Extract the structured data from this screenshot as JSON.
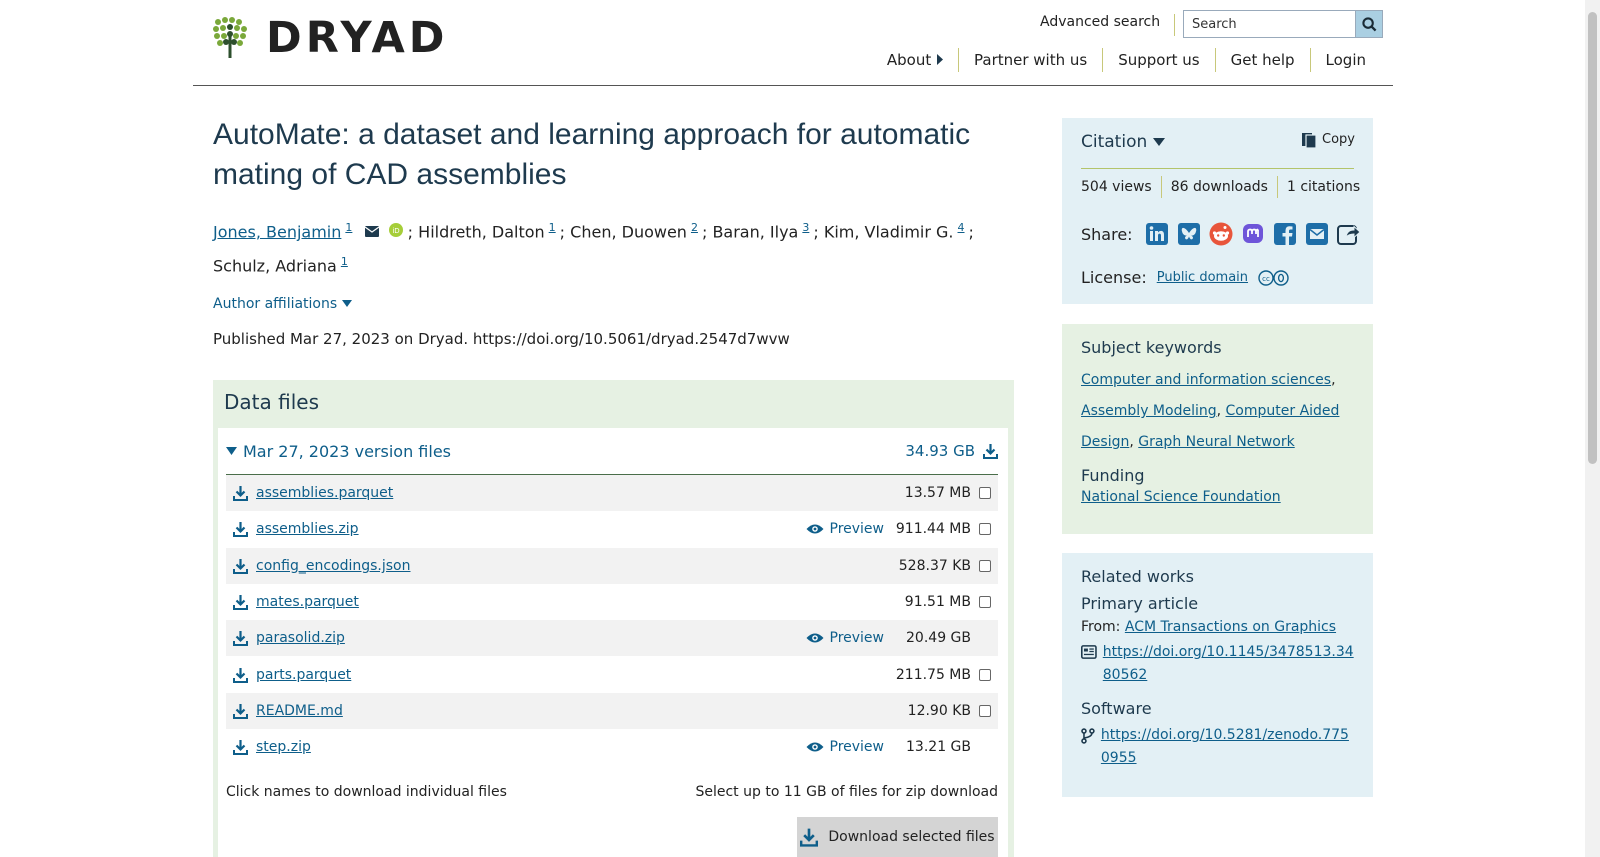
{
  "header": {
    "logo_text": "DRYAD",
    "advanced_search": "Advanced search",
    "search_placeholder": "Search",
    "nav": [
      "About",
      "Partner with us",
      "Support us",
      "Get help",
      "Login"
    ]
  },
  "dataset": {
    "title": "AutoMate: a dataset and learning approach for automatic mating of CAD assemblies",
    "authors": [
      {
        "name": "Jones, Benjamin",
        "aff": "1",
        "linked": true
      },
      {
        "name": "Hildreth, Dalton",
        "aff": "1"
      },
      {
        "name": "Chen, Duowen",
        "aff": "2"
      },
      {
        "name": "Baran, Ilya",
        "aff": "3"
      },
      {
        "name": "Kim, Vladimir G.",
        "aff": "4"
      },
      {
        "name": "Schulz, Adriana",
        "aff": "1"
      }
    ],
    "separator": ";",
    "affiliations_toggle": "Author affiliations",
    "published": "Published Mar 27, 2023 on Dryad. https://doi.org/10.5061/dryad.2547d7wvw"
  },
  "data_files": {
    "heading": "Data files",
    "version_label": "Mar 27, 2023 version files",
    "version_size": "34.93 GB",
    "preview_label": "Preview",
    "files": [
      {
        "name": "assemblies.parquet",
        "size": "13.57 MB",
        "preview": false,
        "checkbox": true
      },
      {
        "name": "assemblies.zip",
        "size": "911.44 MB",
        "preview": true,
        "checkbox": true
      },
      {
        "name": "config_encodings.json",
        "size": "528.37 KB",
        "preview": false,
        "checkbox": true
      },
      {
        "name": "mates.parquet",
        "size": "91.51 MB",
        "preview": false,
        "checkbox": true
      },
      {
        "name": "parasolid.zip",
        "size": "20.49 GB",
        "preview": true,
        "checkbox": false
      },
      {
        "name": "parts.parquet",
        "size": "211.75 MB",
        "preview": false,
        "checkbox": true
      },
      {
        "name": "README.md",
        "size": "12.90 KB",
        "preview": false,
        "checkbox": true
      },
      {
        "name": "step.zip",
        "size": "13.21 GB",
        "preview": true,
        "checkbox": false
      }
    ],
    "note_left": "Click names to download individual files",
    "note_right": "Select up to 11 GB of files for zip download",
    "download_selected": "Download selected files"
  },
  "citation": {
    "heading": "Citation",
    "copy": "Copy",
    "views": "504 views",
    "downloads": "86 downloads",
    "citations": "1 citations",
    "share_label": "Share:",
    "share_icons": [
      "linkedin-icon",
      "bluesky-icon",
      "reddit-icon",
      "mastodon-icon",
      "facebook-icon",
      "email-icon",
      "share-icon"
    ],
    "license_label": "License:",
    "license_value": "Public domain"
  },
  "keywords": {
    "heading": "Subject keywords",
    "items": [
      "Computer and information sciences",
      "Assembly Modeling",
      "Computer Aided Design",
      "Graph Neural Network"
    ],
    "funding_heading": "Funding",
    "funder": "National Science Foundation"
  },
  "related": {
    "heading": "Related works",
    "primary_heading": "Primary article",
    "from_label": "From:",
    "journal": "ACM Transactions on Graphics",
    "article_url": "https://doi.org/10.1145/3478513.3480562",
    "software_heading": "Software",
    "software_url": "https://doi.org/10.5281/zenodo.7750955"
  },
  "colors": {
    "link": "#0e5e8a",
    "green_panel": "#e6f1e3",
    "blue_panel": "#e3f0f5",
    "title": "#1e3a4e"
  }
}
